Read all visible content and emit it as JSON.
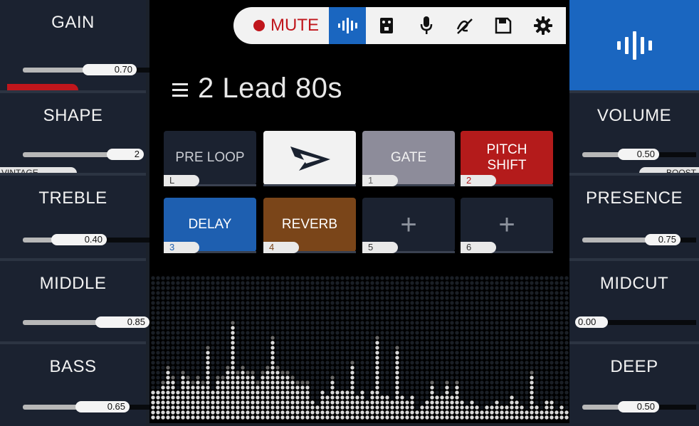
{
  "left_panel": [
    {
      "label": "GAIN",
      "value": "0.70",
      "fraction": 0.7
    },
    {
      "label": "SHAPE",
      "value": "2",
      "fraction": 1.0
    },
    {
      "label": "TREBLE",
      "value": "0.40",
      "fraction": 0.4
    },
    {
      "label": "MIDDLE",
      "value": "0.85",
      "fraction": 0.85
    },
    {
      "label": "BASS",
      "value": "0.65",
      "fraction": 0.65
    }
  ],
  "left_tags": {
    "vintage": "VINTAGE"
  },
  "right_panel": [
    {
      "label": "VOLUME",
      "value": "0.50",
      "fraction": 0.5
    },
    {
      "label": "PRESENCE",
      "value": "0.75",
      "fraction": 0.75
    },
    {
      "label": "MIDCUT",
      "value": "0.00",
      "fraction": 0.0
    },
    {
      "label": "DEEP",
      "value": "0.50",
      "fraction": 0.5
    }
  ],
  "right_tags": {
    "boost": "BOOST"
  },
  "toolbar": {
    "mute_label": "MUTE",
    "icons": [
      "levels-icon",
      "pedal-icon",
      "microphone-icon",
      "tuner-icon",
      "save-icon",
      "gear-icon"
    ],
    "active": "levels-icon"
  },
  "preset": {
    "name": "2 Lead 80s"
  },
  "blocks": [
    {
      "label": "PRE LOOP",
      "num": "L",
      "bg": "#1b2230",
      "fg": "#c9ccd2",
      "numcolor": "#333"
    },
    {
      "label": "",
      "num": "",
      "bg": "#f2f2f2",
      "fg": "#1a2230",
      "logo": true
    },
    {
      "label": "GATE",
      "num": "1",
      "bg": "#8d8c9a",
      "fg": "#f2f2f2",
      "numcolor": "#666"
    },
    {
      "label": "PITCH\nSHIFT",
      "num": "2",
      "bg": "#b41b1b",
      "fg": "#ffffff",
      "numcolor": "#b41b1b"
    },
    {
      "label": "DELAY",
      "num": "3",
      "bg": "#1e5fb0",
      "fg": "#ffffff",
      "numcolor": "#1e5fb0"
    },
    {
      "label": "REVERB",
      "num": "4",
      "bg": "#7a4519",
      "fg": "#ffffff",
      "numcolor": "#7a4519"
    },
    {
      "label": "+",
      "num": "5",
      "bg": "#1b2230",
      "fg": "#8c929c",
      "numcolor": "#333",
      "plus": true
    },
    {
      "label": "+",
      "num": "6",
      "bg": "#1b2230",
      "fg": "#8c929c",
      "numcolor": "#333",
      "plus": true
    }
  ],
  "colors": {
    "accent_blue": "#1a66c0",
    "mute_red": "#c0161c",
    "gain_indicator": "#c0161c"
  }
}
